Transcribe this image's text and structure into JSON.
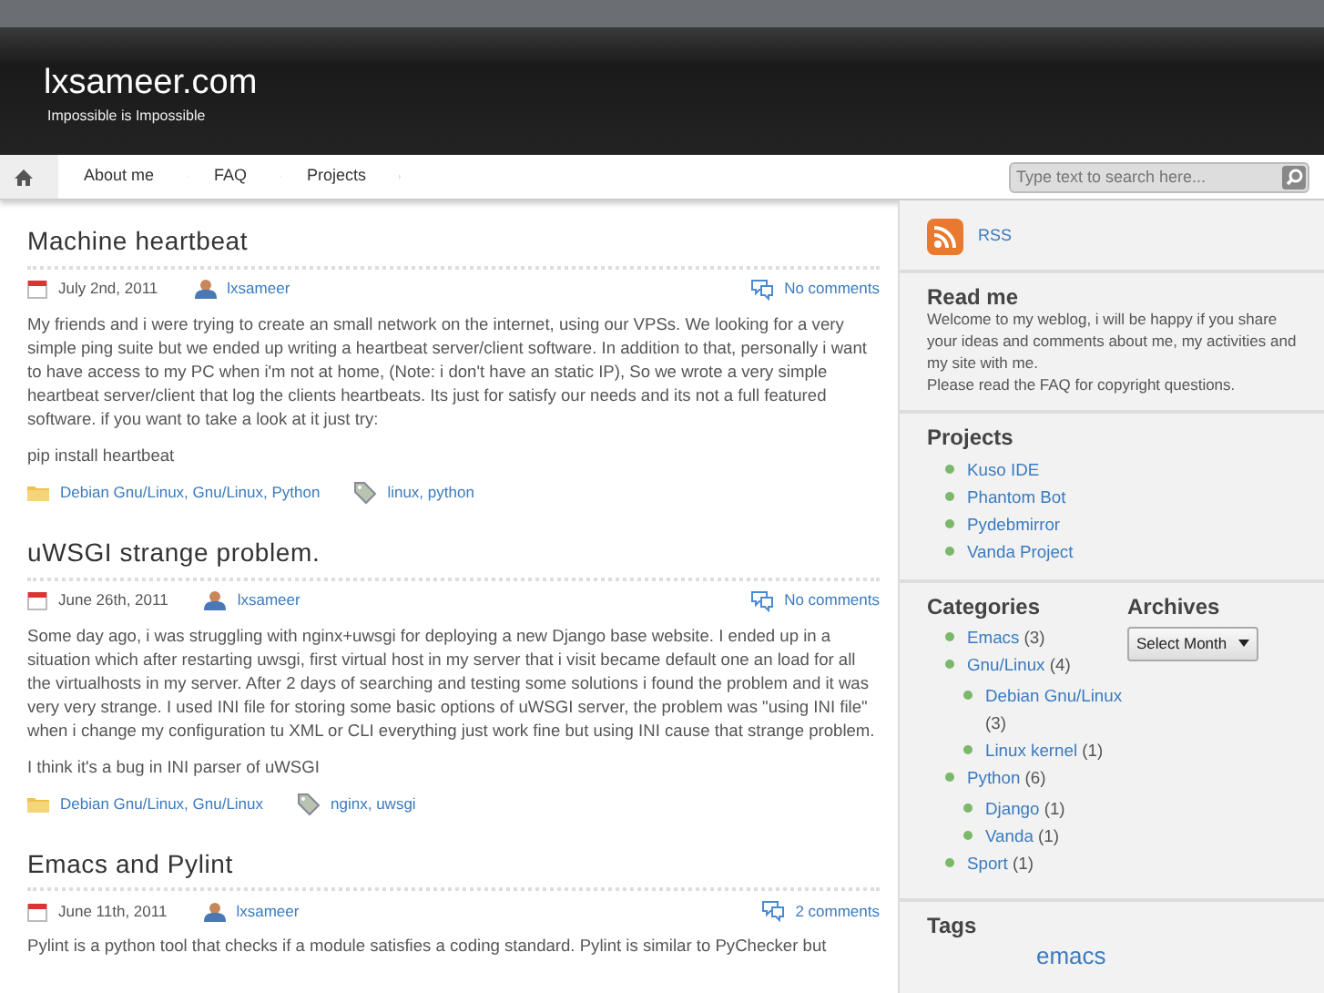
{
  "site": {
    "title": "lxsameer.com",
    "tagline": "Impossible is Impossible"
  },
  "nav": {
    "items": [
      {
        "label": "About me",
        "selected": false
      },
      {
        "label": "FAQ",
        "selected": false
      },
      {
        "label": "Projects",
        "selected": false
      }
    ],
    "search": {
      "placeholder": "Type text to search here..."
    }
  },
  "posts": [
    {
      "title": "Machine heartbeat",
      "date": "July 2nd, 2011",
      "author": "lxsameer",
      "comments": "No comments",
      "paragraphs": [
        "My friends and i were trying to create an small network on the internet, using our VPSs. We looking for a very simple ping suite but we ended up writing a heartbeat server/client software. In addition to that, personally i want to have access to my PC when i'm not at home, (Note: i don't have an static IP), So we wrote a very simple heartbeat server/client that log the clients heartbeats. Its just for satisfy our needs and its not a full featured software. if you want to take a look at it just try:",
        "pip install heartbeat"
      ],
      "categories": "Debian Gnu/Linux, Gnu/Linux, Python",
      "tags": "linux, python"
    },
    {
      "title": "uWSGI strange problem.",
      "date": "June 26th, 2011",
      "author": "lxsameer",
      "comments": "No comments",
      "paragraphs": [
        "Some day ago, i was struggling with nginx+uwsgi for deploying a new Django base website. I ended up in a situation which after restarting uwsgi, first virtual host in my server that i visit became default one an load for all the virtualhosts in my server. After 2 days of searching and testing some solutions i found the problem and it was very very strange. I used INI file for storing some basic options of uWSGI server, the problem was \"using INI file\" when i change my configuration tu XML or CLI everything just work fine but using INI cause that strange problem.",
        "I think it's a bug in INI parser of uWSGI"
      ],
      "categories": "Debian Gnu/Linux, Gnu/Linux",
      "tags": "nginx, uwsgi"
    },
    {
      "title": "Emacs and Pylint",
      "date": "June 11th, 2011",
      "author": "lxsameer",
      "comments": "2 comments",
      "paragraphs": [
        "Pylint is a python tool that checks if a module satisfies a coding standard. Pylint is similar to PyChecker but"
      ]
    }
  ],
  "sidebar": {
    "rss": "RSS",
    "read_me": {
      "title": "Read me",
      "lines": [
        "Welcome to my weblog, i will be happy if you share your ideas and comments about me, my activities and my site with me.",
        "Please read the FAQ for copyright questions."
      ]
    },
    "projects": {
      "title": "Projects",
      "items": [
        "Kuso IDE",
        "Phantom Bot",
        "Pydebmirror",
        "Vanda Project"
      ]
    },
    "categories": {
      "title": "Categories",
      "items": [
        {
          "label": "Emacs",
          "count": "(3)"
        },
        {
          "label": "Gnu/Linux",
          "count": "(4)",
          "children": [
            {
              "label": "Debian Gnu/Linux",
              "count": "(3)"
            },
            {
              "label": "Linux kernel",
              "count": "(1)"
            }
          ]
        },
        {
          "label": "Python",
          "count": "(6)",
          "children": [
            {
              "label": "Django",
              "count": "(1)"
            },
            {
              "label": "Vanda",
              "count": "(1)"
            }
          ]
        },
        {
          "label": "Sport",
          "count": "(1)"
        }
      ]
    },
    "archives": {
      "title": "Archives",
      "select": "Select Month"
    },
    "tags": {
      "title": "Tags",
      "items": [
        "emacs"
      ]
    }
  }
}
